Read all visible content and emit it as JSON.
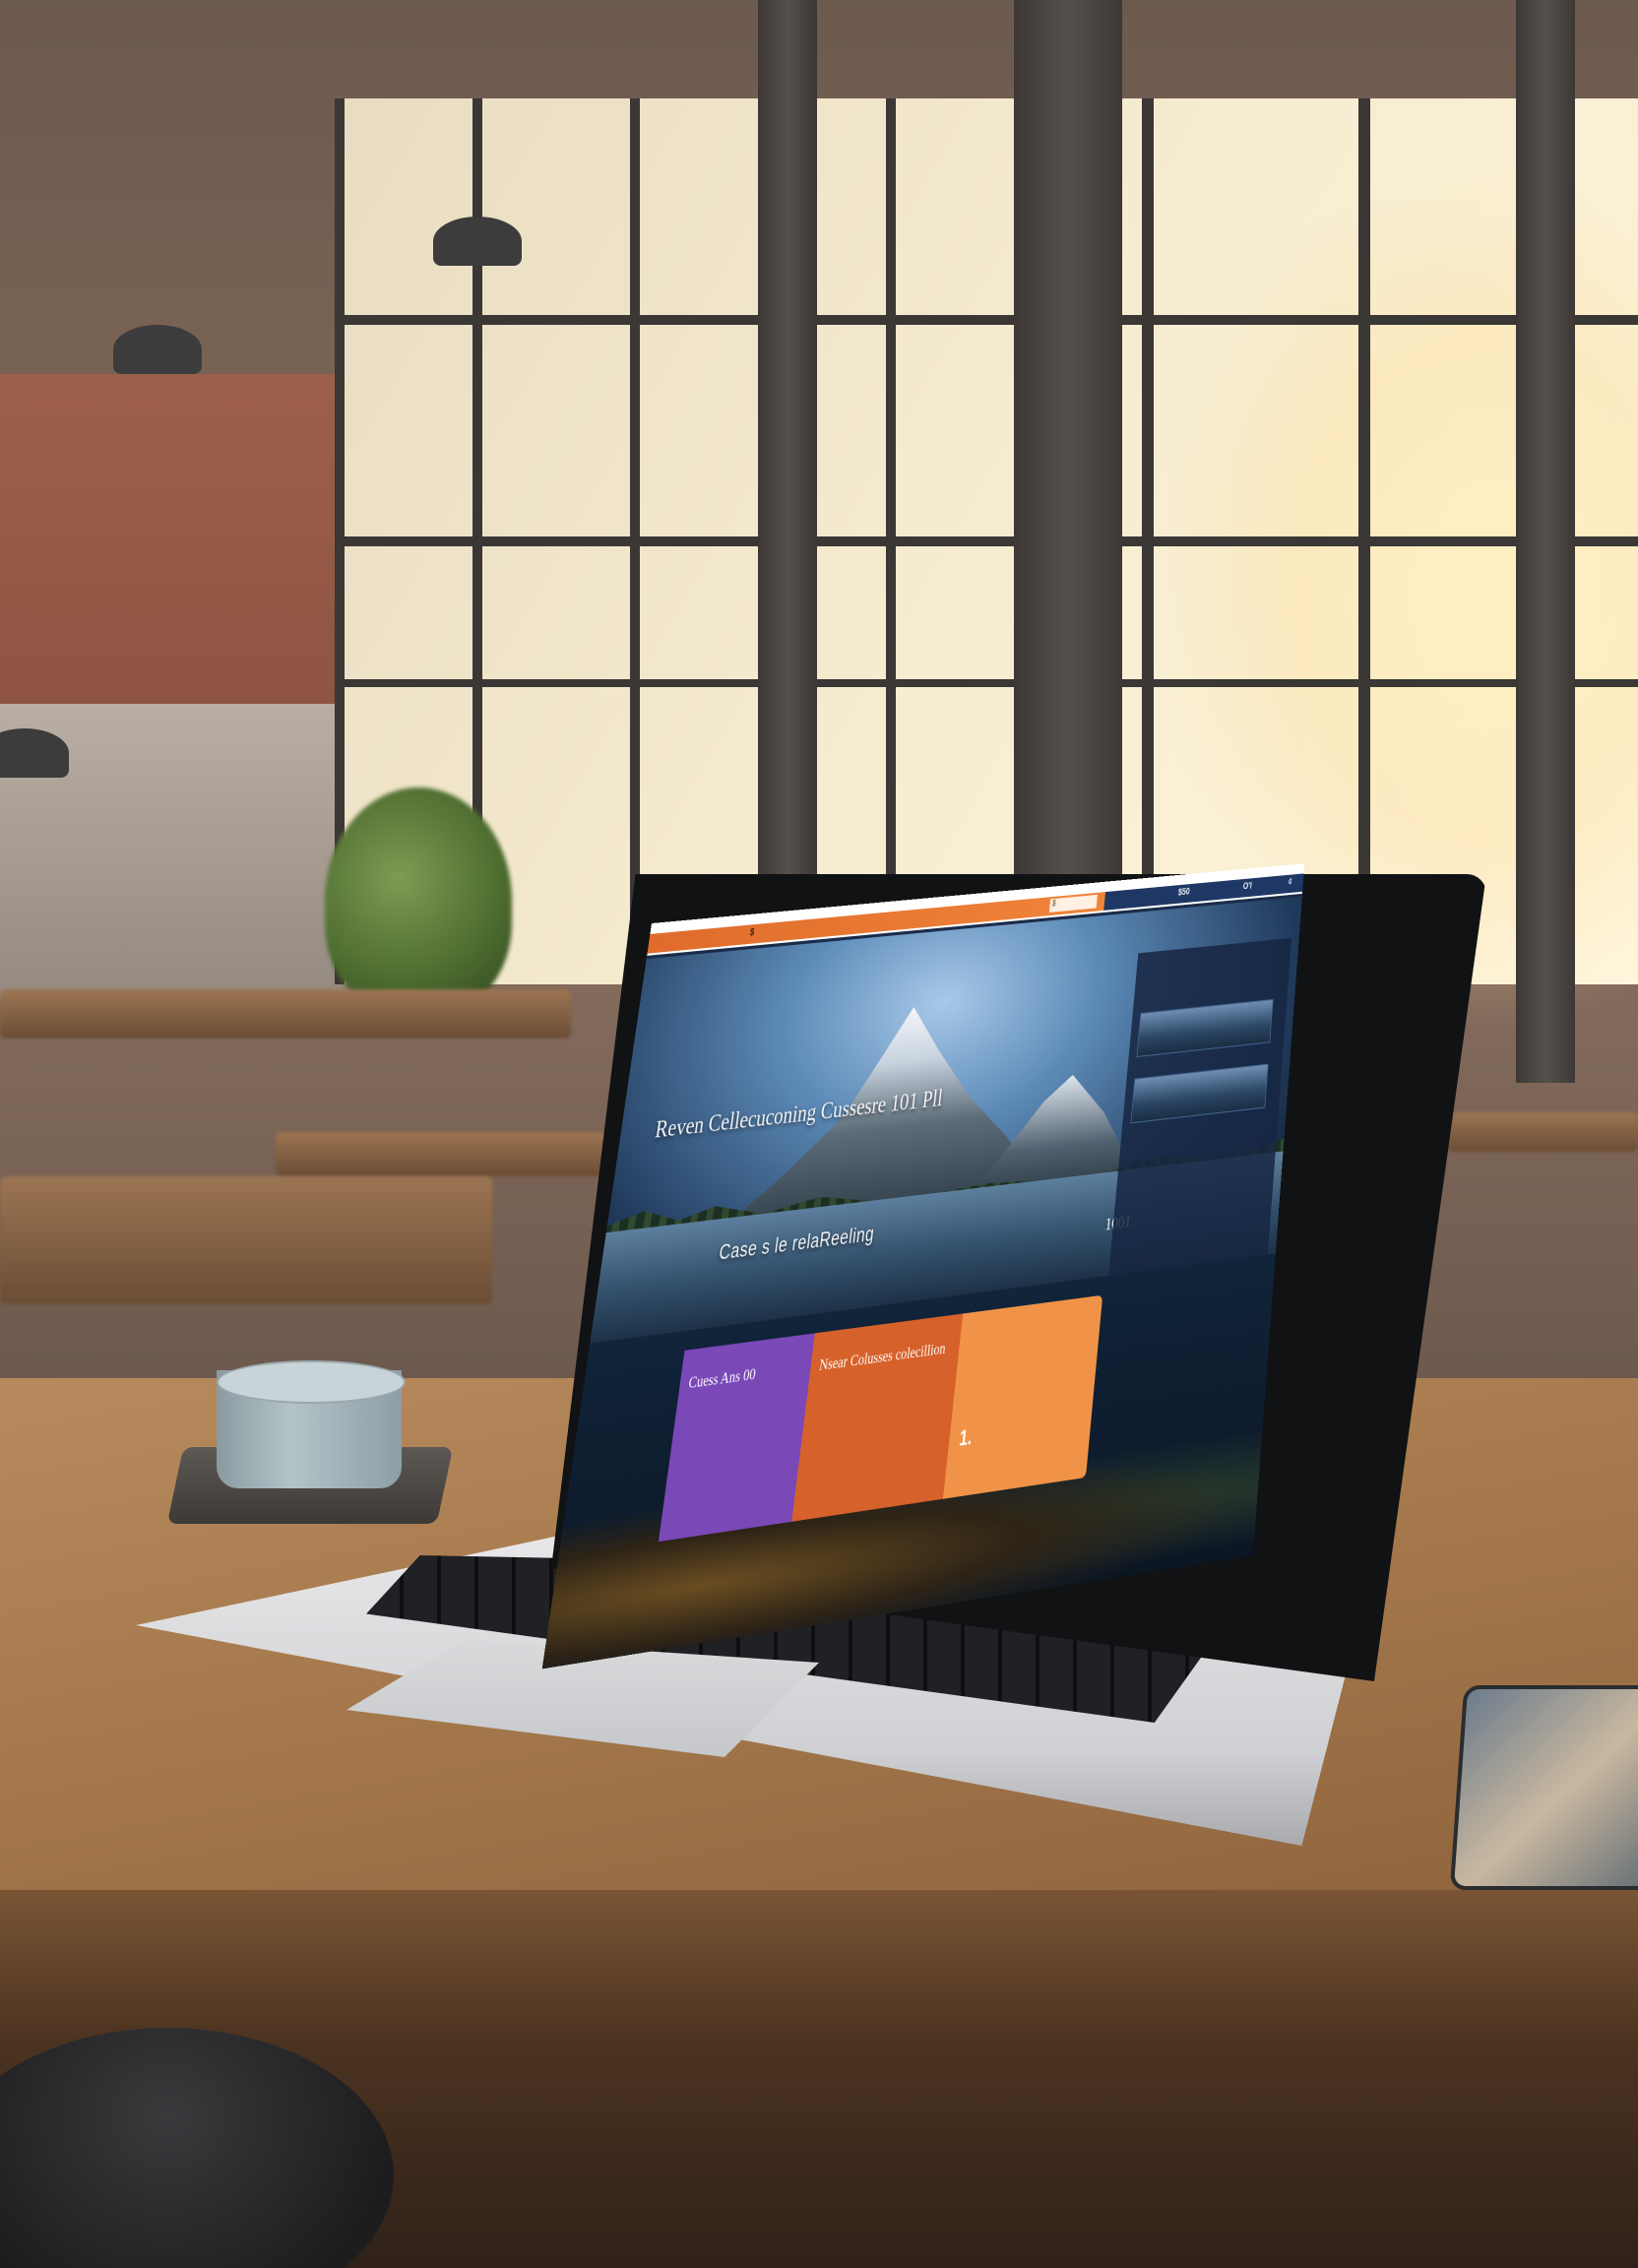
{
  "screen": {
    "nav": {
      "items": [
        "",
        "$",
        "",
        "",
        "",
        "$50",
        "O'l",
        "₫"
      ],
      "search_value": "$ "
    },
    "hero": {
      "top_label": "",
      "title": "Reven Cellecuconing Cussesre 101 Pll",
      "subtitle": "Case s le relaReeling",
      "side_number": "1001"
    },
    "side_panel": {
      "lines": [
        "",
        "",
        "",
        "",
        "",
        "",
        ""
      ]
    },
    "cards": [
      {
        "title": "Cuess Ans 00",
        "lines": [
          "",
          ""
        ],
        "color": "#7a48b7"
      },
      {
        "title": "Nsear Colusses colecillion",
        "lines": [
          "",
          "",
          ""
        ],
        "color": "#d6612a"
      },
      {
        "title": "",
        "big": "1.",
        "lines": [
          "",
          ""
        ],
        "color": "#f09348"
      }
    ]
  },
  "colors": {
    "nav_orange": "#e06b2c",
    "nav_blue": "#1f3764",
    "table_wood": "#a77a4d"
  }
}
